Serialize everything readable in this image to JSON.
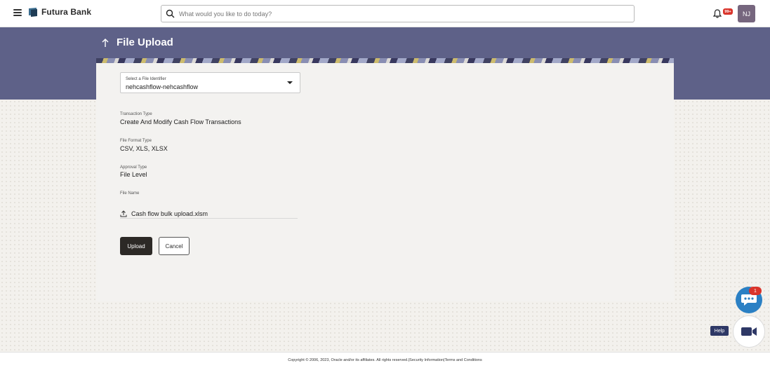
{
  "header": {
    "brand": "Futura Bank",
    "search_placeholder": "What would you like to do today?",
    "notification_badge": "99+",
    "avatar_initials": "NJ"
  },
  "page": {
    "title": "File Upload"
  },
  "form": {
    "file_identifier_label": "Select a File Identifier",
    "file_identifier_value": "nehcashflow-nehcashflow",
    "transaction_type_label": "Transaction Type",
    "transaction_type_value": "Create And Modify Cash Flow Transactions",
    "file_format_label": "File Format Type",
    "file_format_value": "CSV, XLS, XLSX",
    "approval_type_label": "Approval Type",
    "approval_type_value": "File Level",
    "file_name_label": "File Name",
    "file_name_value": "Cash flow bulk upload.xlsm",
    "upload_label": "Upload",
    "cancel_label": "Cancel"
  },
  "widgets": {
    "chat_badge": "1",
    "help_label": "Help"
  },
  "footer": {
    "copyright": "Copyright © 2006, 2023, Oracle and/or its affiliates. All rights reserved.",
    "separator": "|",
    "security_link": "Security Information",
    "terms_link": "Terms and Conditions"
  },
  "colors": {
    "banner": "#5e6188",
    "primary_button": "#2c2926",
    "chat_button": "#2b80c4",
    "badge": "#d9342b"
  },
  "icons": [
    "hamburger-icon",
    "bank-logo-icon",
    "search-icon",
    "bell-icon",
    "back-arrow-icon",
    "dropdown-caret-icon",
    "upload-icon",
    "chat-icon",
    "video-icon"
  ]
}
